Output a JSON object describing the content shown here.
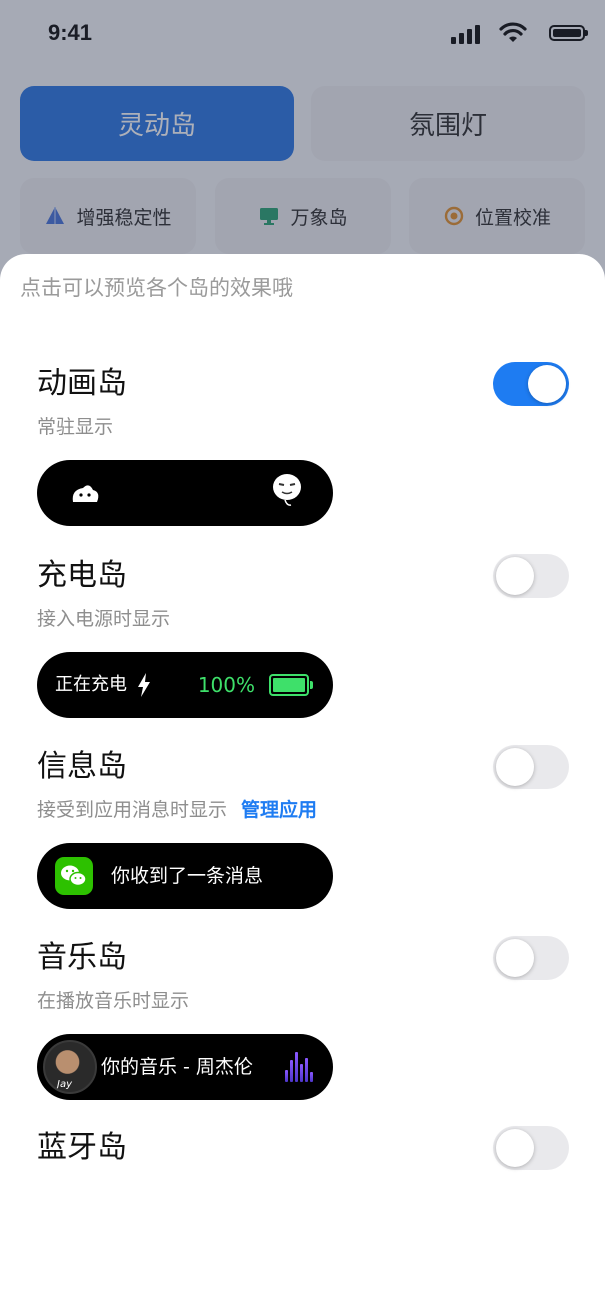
{
  "status_bar": {
    "time": "9:41"
  },
  "tabs": [
    {
      "label": "灵动岛",
      "active": true
    },
    {
      "label": "氛围灯",
      "active": false
    }
  ],
  "chips": [
    {
      "label": "增强稳定性",
      "icon": "pyramid-icon",
      "color": "#3d6bd6"
    },
    {
      "label": "万象岛",
      "icon": "monitor-icon",
      "color": "#1e9d6b"
    },
    {
      "label": "位置校准",
      "icon": "target-icon",
      "color": "#e08a22"
    }
  ],
  "sheet": {
    "hint": "点击可以预览各个岛的效果哦",
    "items": [
      {
        "title": "动画岛",
        "subtitle": "常驻显示",
        "enabled": true
      },
      {
        "title": "充电岛",
        "subtitle": "接入电源时显示",
        "enabled": false,
        "preview": {
          "label": "正在充电",
          "percent": "100%"
        }
      },
      {
        "title": "信息岛",
        "subtitle": "接受到应用消息时显示",
        "link": "管理应用",
        "enabled": false,
        "preview": {
          "label": "你收到了一条消息"
        }
      },
      {
        "title": "音乐岛",
        "subtitle": "在播放音乐时显示",
        "enabled": false,
        "preview": {
          "label": "你的音乐 - 周杰伦",
          "avatar_text": "Jay"
        }
      },
      {
        "title": "蓝牙岛",
        "enabled": false
      }
    ]
  },
  "colors": {
    "accent": "#1e7cf2",
    "charge_green": "#3ee06a",
    "wechat_green": "#2dc100"
  }
}
